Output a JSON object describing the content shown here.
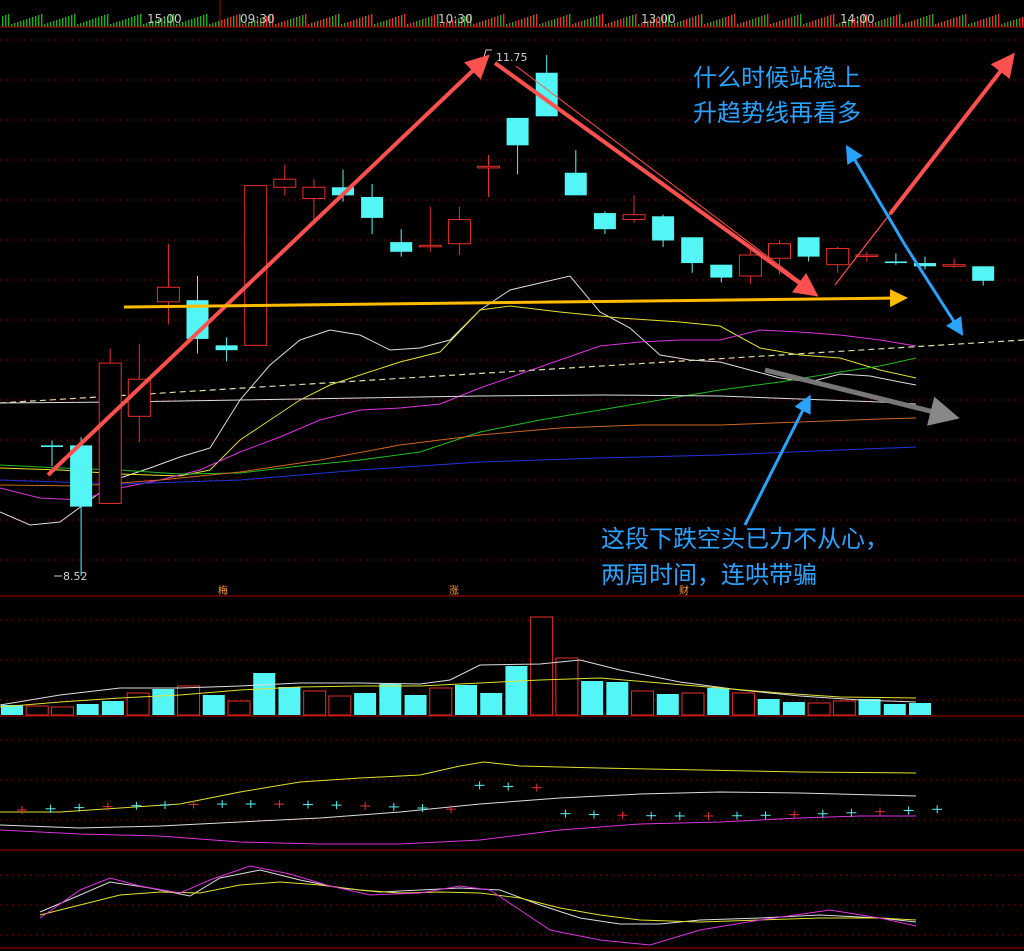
{
  "chart_data": {
    "type": "candlestick",
    "time_labels": [
      "15:00",
      "09:30",
      "10:30",
      "13:00",
      "14:00"
    ],
    "high_label": "11.75",
    "low_label": "8.52",
    "candles": [
      {
        "o": 9.33,
        "h": 9.36,
        "l": 9.2,
        "c": 9.32
      },
      {
        "o": 9.33,
        "h": 9.38,
        "l": 8.52,
        "c": 8.95
      },
      {
        "o": 8.97,
        "h": 9.93,
        "l": 8.97,
        "c": 9.84
      },
      {
        "o": 9.51,
        "h": 9.96,
        "l": 9.35,
        "c": 9.74
      },
      {
        "o": 10.22,
        "h": 10.58,
        "l": 10.08,
        "c": 10.31
      },
      {
        "o": 10.23,
        "h": 10.38,
        "l": 9.9,
        "c": 9.99
      },
      {
        "o": 9.95,
        "h": 10.0,
        "l": 9.85,
        "c": 9.92
      },
      {
        "o": 9.95,
        "h": 10.94,
        "l": 9.95,
        "c": 10.94
      },
      {
        "o": 10.93,
        "h": 11.07,
        "l": 10.88,
        "c": 10.98
      },
      {
        "o": 10.86,
        "h": 10.98,
        "l": 10.71,
        "c": 10.93
      },
      {
        "o": 10.93,
        "h": 11.04,
        "l": 10.84,
        "c": 10.88
      },
      {
        "o": 10.87,
        "h": 10.95,
        "l": 10.64,
        "c": 10.74
      },
      {
        "o": 10.59,
        "h": 10.67,
        "l": 10.5,
        "c": 10.53
      },
      {
        "o": 10.57,
        "h": 10.81,
        "l": 10.53,
        "c": 10.57
      },
      {
        "o": 10.58,
        "h": 10.81,
        "l": 10.51,
        "c": 10.73
      },
      {
        "o": 11.05,
        "h": 11.13,
        "l": 10.87,
        "c": 11.06
      },
      {
        "o": 11.36,
        "h": 11.36,
        "l": 11.01,
        "c": 11.19
      },
      {
        "o": 11.64,
        "h": 11.75,
        "l": 11.37,
        "c": 11.37
      },
      {
        "o": 11.02,
        "h": 11.16,
        "l": 10.88,
        "c": 10.88
      },
      {
        "o": 10.77,
        "h": 10.78,
        "l": 10.64,
        "c": 10.67
      },
      {
        "o": 10.73,
        "h": 10.88,
        "l": 10.71,
        "c": 10.76
      },
      {
        "o": 10.75,
        "h": 10.76,
        "l": 10.56,
        "c": 10.6
      },
      {
        "o": 10.62,
        "h": 10.62,
        "l": 10.4,
        "c": 10.46
      },
      {
        "o": 10.45,
        "h": 10.45,
        "l": 10.34,
        "c": 10.37
      },
      {
        "o": 10.38,
        "h": 10.54,
        "l": 10.33,
        "c": 10.51
      },
      {
        "o": 10.49,
        "h": 10.6,
        "l": 10.39,
        "c": 10.58
      },
      {
        "o": 10.62,
        "h": 10.62,
        "l": 10.47,
        "c": 10.5
      },
      {
        "o": 10.45,
        "h": 10.56,
        "l": 10.4,
        "c": 10.55
      },
      {
        "o": 10.51,
        "h": 10.53,
        "l": 10.47,
        "c": 10.51
      },
      {
        "o": 10.47,
        "h": 10.52,
        "l": 10.45,
        "c": 10.46
      },
      {
        "o": 10.46,
        "h": 10.5,
        "l": 10.42,
        "c": 10.44
      },
      {
        "o": 10.44,
        "h": 10.49,
        "l": 10.43,
        "c": 10.45
      },
      {
        "o": 10.44,
        "h": 10.44,
        "l": 10.32,
        "c": 10.35
      }
    ],
    "volume": [
      10,
      9,
      8,
      11,
      14,
      22,
      26,
      29,
      20,
      14,
      42,
      28,
      24,
      19,
      22,
      31,
      20,
      27,
      30,
      22,
      49,
      98,
      57,
      34,
      33,
      24,
      21,
      22,
      27,
      22,
      16,
      13,
      12,
      14,
      16,
      11,
      12
    ],
    "annotations": [
      {
        "text": "什么时候站稳上",
        "color": "#2aa3ff"
      },
      {
        "text": "升趋势线再看多",
        "color": "#2aa3ff"
      },
      {
        "text": "这段下跌空头已力不从心，",
        "color": "#2aa3ff"
      },
      {
        "text": "两周时间，连哄带骗",
        "color": "#2aa3ff"
      }
    ],
    "markers": [
      "梅",
      "涨",
      "财"
    ],
    "colors": {
      "background": "#000000",
      "up": "#e8302c",
      "down": "#54f5f5",
      "grid": "#7a0000",
      "border": "#b00000",
      "arrow_red": "#ff5050",
      "arrow_yellow": "#ffbb00",
      "arrow_blue": "#2aa3ff",
      "arrow_gray": "#888888",
      "ma_white": "#dddddd",
      "ma_yellow": "#e0e030",
      "ma_magenta": "#dd33dd",
      "ma_green": "#22bb22",
      "ma_orange": "#cc6622",
      "ma_blue": "#2233dd"
    }
  }
}
